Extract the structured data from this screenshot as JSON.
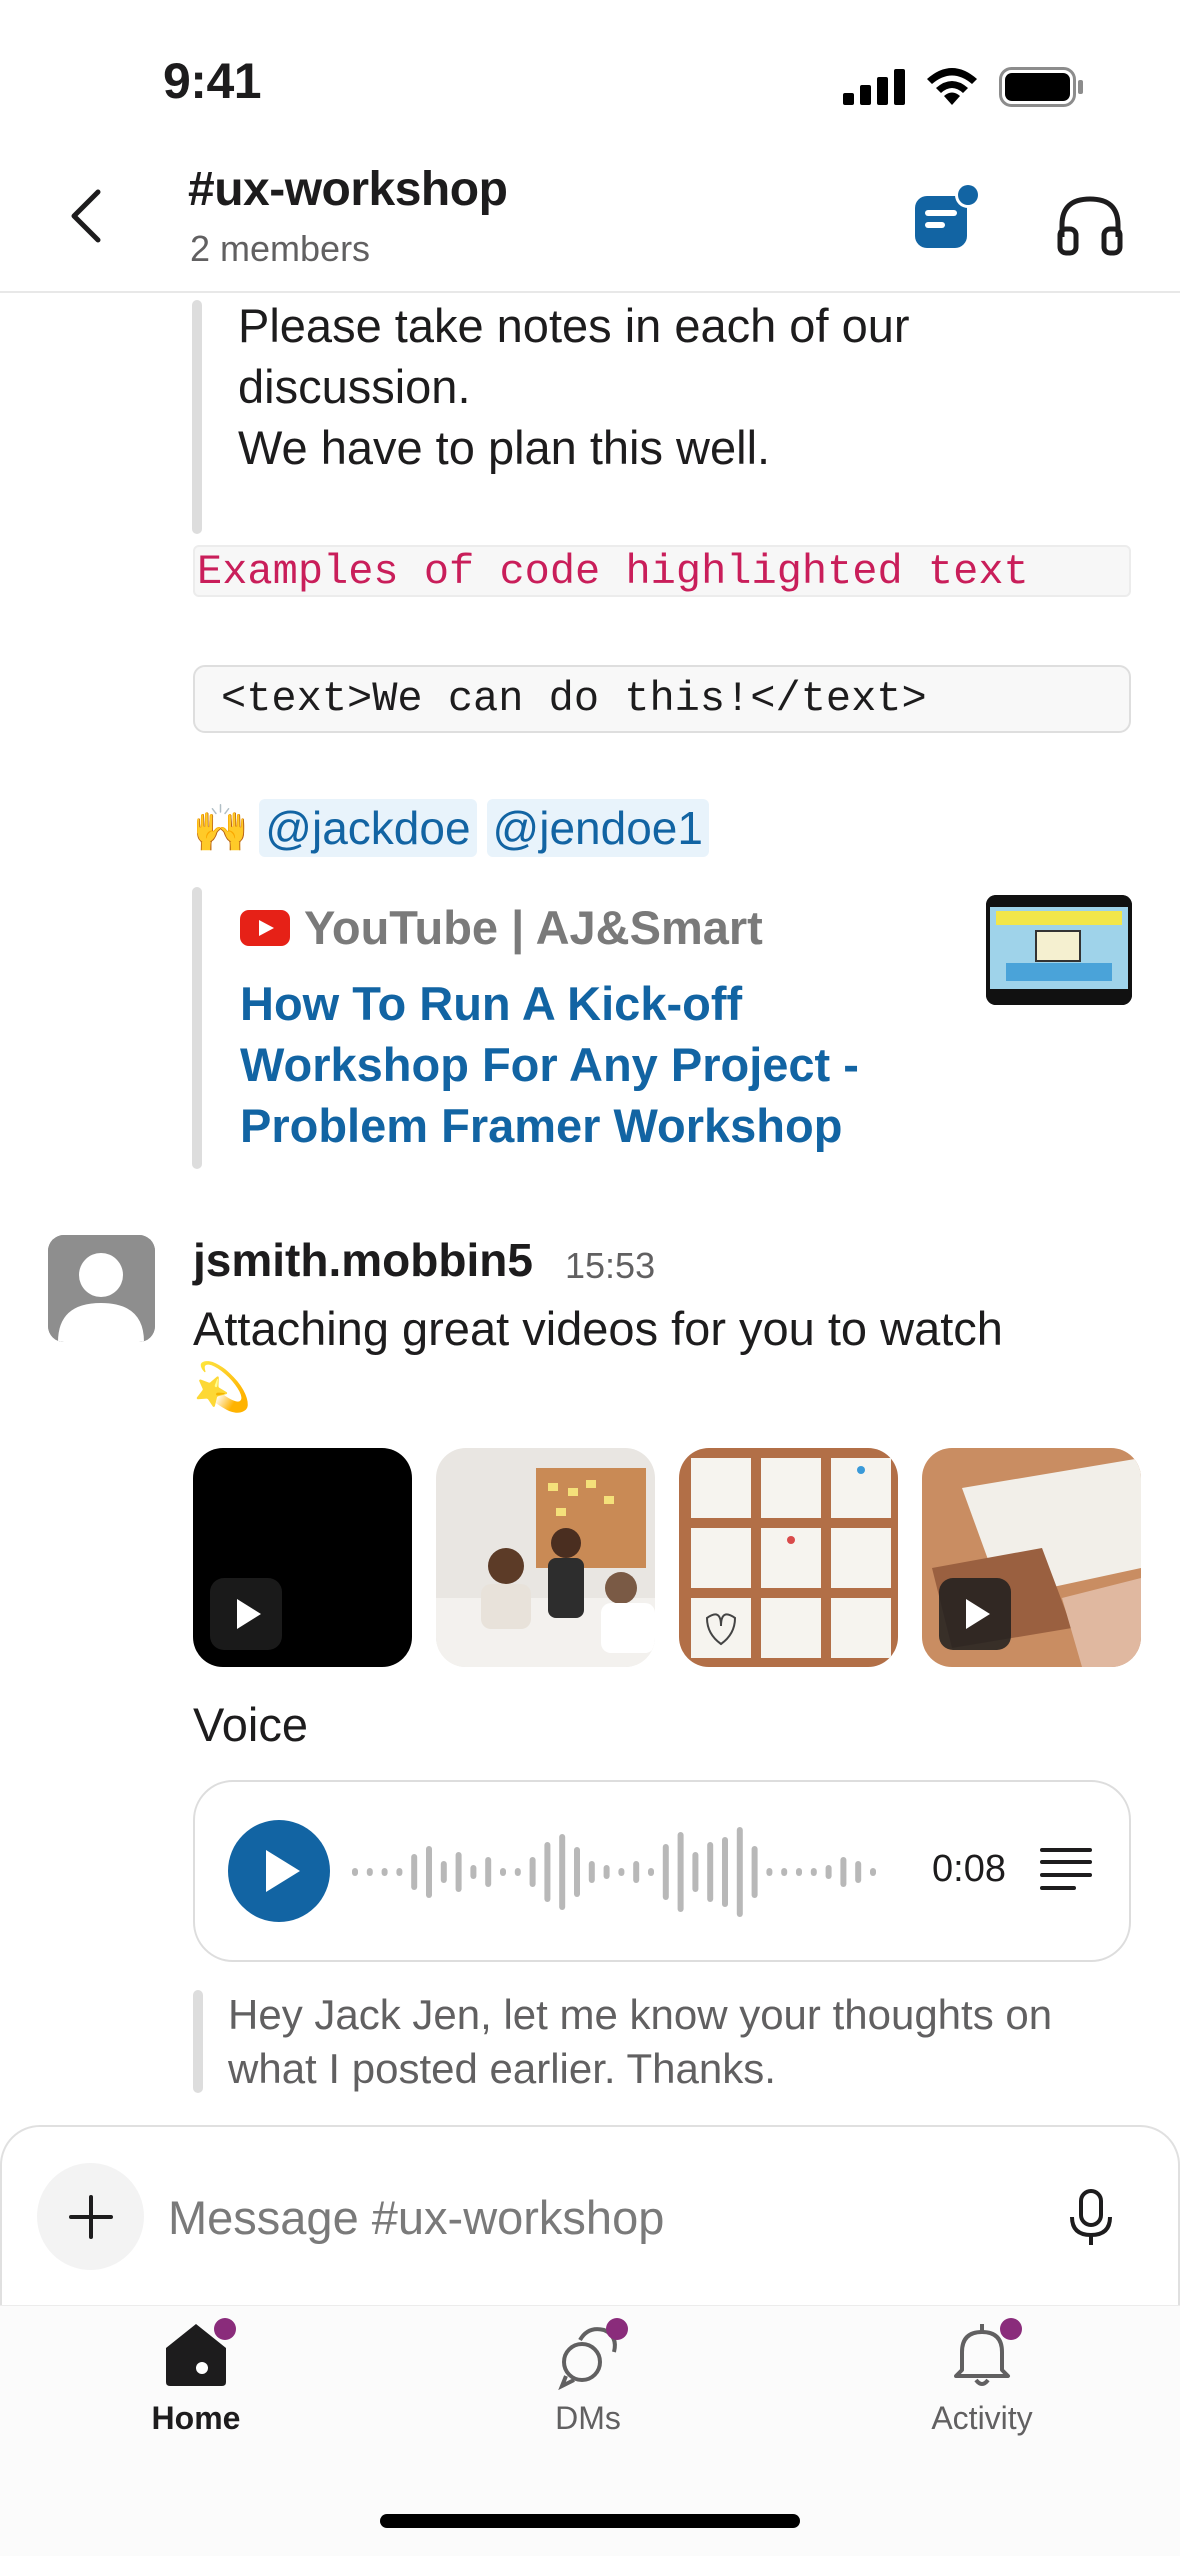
{
  "status_bar": {
    "time": "9:41"
  },
  "header": {
    "channel_name": "#ux-workshop",
    "member_count": "2 members"
  },
  "quote": {
    "lines": [
      "Please take notes in each of our",
      "discussion.",
      "We have to plan this well."
    ]
  },
  "code_inline": "Examples of code highlighted text",
  "code_block": "<text>We can do this!</text>",
  "mentions": {
    "emoji": "🙌",
    "users": [
      "@jackdoe",
      "@jendoe1"
    ]
  },
  "link_preview": {
    "source": "YouTube | AJ&Smart",
    "title_lines": [
      "How To Run A Kick-off",
      "Workshop For Any Project -",
      "Problem Framer Workshop"
    ]
  },
  "message": {
    "author": "jsmith.mobbin5",
    "time": "15:53",
    "text": "Attaching great videos for you to watch",
    "emoji": "💫",
    "voice_label": "Voice",
    "voice_duration": "0:08",
    "reply_text": "Hey Jack Jen, let me know your thoughts on what I posted earlier. Thanks."
  },
  "composer": {
    "placeholder": "Message #ux-workshop"
  },
  "tabs": [
    {
      "label": "Home",
      "active": true
    },
    {
      "label": "DMs",
      "active": false
    },
    {
      "label": "Activity",
      "active": false
    }
  ],
  "colors": {
    "link_blue": "#1264a3",
    "code_pink": "#c91e5a",
    "notification_dot": "#8a2c7b",
    "muted_text": "#616061"
  }
}
